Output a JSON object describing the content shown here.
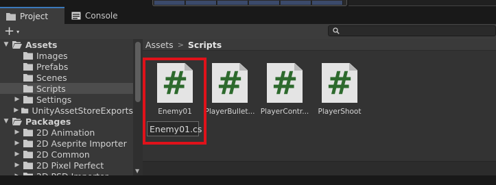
{
  "tabs": [
    {
      "label": "Project",
      "icon": "folder-icon",
      "active": true
    },
    {
      "label": "Console",
      "icon": "console-icon",
      "active": false
    }
  ],
  "toolbar": {
    "create_label": "+",
    "create_caret": "▾",
    "search_placeholder": ""
  },
  "tree": [
    {
      "label": "Assets",
      "depth": 0,
      "expanded": true,
      "bold": true,
      "selected": false
    },
    {
      "label": "Images",
      "depth": 1,
      "expanded": null,
      "bold": false,
      "selected": false
    },
    {
      "label": "Prefabs",
      "depth": 1,
      "expanded": null,
      "bold": false,
      "selected": false
    },
    {
      "label": "Scenes",
      "depth": 1,
      "expanded": null,
      "bold": false,
      "selected": false
    },
    {
      "label": "Scripts",
      "depth": 1,
      "expanded": null,
      "bold": false,
      "selected": true
    },
    {
      "label": "Settings",
      "depth": 1,
      "expanded": false,
      "bold": false,
      "selected": false
    },
    {
      "label": "UnityAssetStoreExports",
      "depth": 1,
      "expanded": false,
      "bold": false,
      "selected": false
    },
    {
      "label": "Packages",
      "depth": 0,
      "expanded": true,
      "bold": true,
      "selected": false
    },
    {
      "label": "2D Animation",
      "depth": 1,
      "expanded": false,
      "bold": false,
      "selected": false
    },
    {
      "label": "2D Aseprite Importer",
      "depth": 1,
      "expanded": false,
      "bold": false,
      "selected": false
    },
    {
      "label": "2D Common",
      "depth": 1,
      "expanded": false,
      "bold": false,
      "selected": false
    },
    {
      "label": "2D Pixel Perfect",
      "depth": 1,
      "expanded": false,
      "bold": false,
      "selected": false
    },
    {
      "label": "2D PSD Importer",
      "depth": 1,
      "expanded": false,
      "bold": false,
      "selected": false
    }
  ],
  "breadcrumb": {
    "root": "Assets",
    "separator": ">",
    "current": "Scripts"
  },
  "assets": [
    {
      "name": "Enemy01",
      "glyph": "#"
    },
    {
      "name": "PlayerBullet...",
      "glyph": "#"
    },
    {
      "name": "PlayerContr...",
      "glyph": "#"
    },
    {
      "name": "PlayerShoot",
      "glyph": "#"
    }
  ],
  "rename_field": {
    "value": "Enemy01.cs"
  },
  "colors": {
    "accent_tab": "#3a79bb",
    "highlight_box": "#e0121a",
    "script_glyph": "#2d6a2d",
    "panel_bg": "#383838",
    "content_bg": "#333333"
  }
}
